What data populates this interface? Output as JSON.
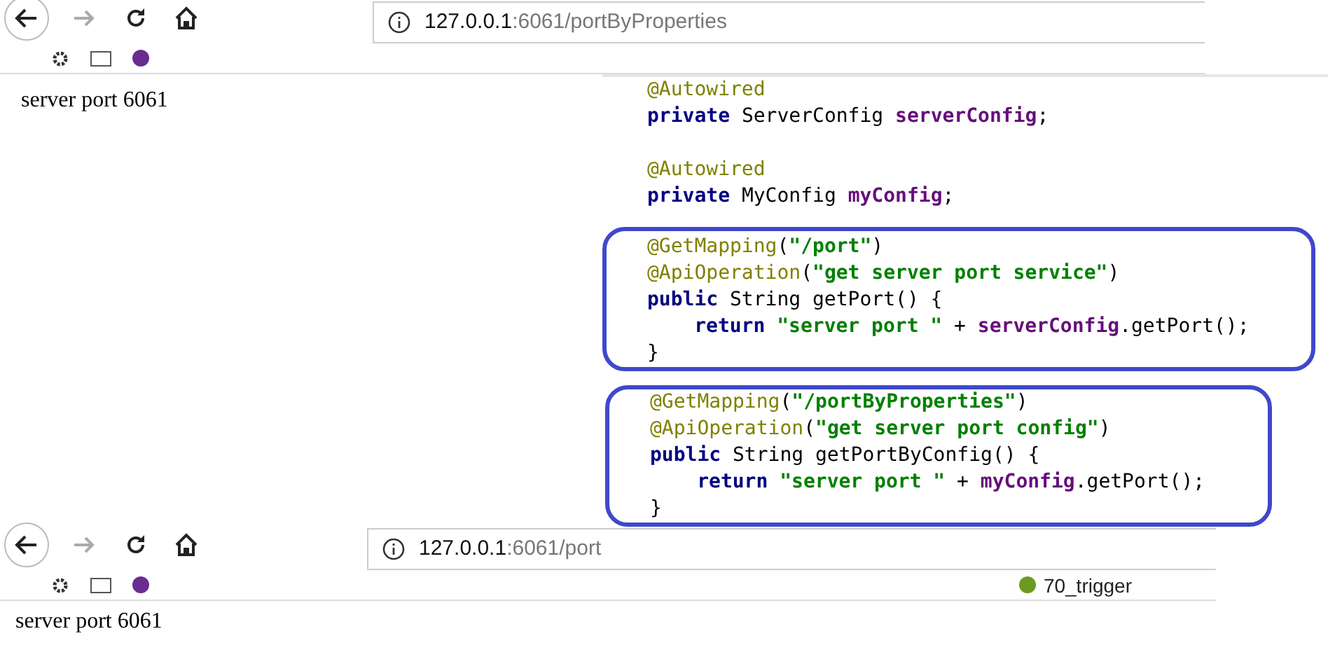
{
  "top_browser": {
    "url_host": "127.0.0.1",
    "url_path": ":6061/portByProperties",
    "page_text": "server port 6061"
  },
  "code": {
    "blocks": [
      {
        "highlighted": false,
        "lines": [
          {
            "indented": false,
            "tokens": [
              {
                "kind": "annotation",
                "text": "@Autowired"
              }
            ]
          },
          {
            "indented": false,
            "tokens": [
              {
                "kind": "keyword",
                "text": "private"
              },
              {
                "kind": "plain",
                "text": " ServerConfig "
              },
              {
                "kind": "field",
                "text": "serverConfig"
              },
              {
                "kind": "plain",
                "text": ";"
              }
            ]
          }
        ]
      },
      {
        "highlighted": false,
        "lines": [
          {
            "indented": false,
            "tokens": [
              {
                "kind": "annotation",
                "text": "@Autowired"
              }
            ]
          },
          {
            "indented": false,
            "tokens": [
              {
                "kind": "keyword",
                "text": "private"
              },
              {
                "kind": "plain",
                "text": " MyConfig "
              },
              {
                "kind": "field",
                "text": "myConfig"
              },
              {
                "kind": "plain",
                "text": ";"
              }
            ]
          }
        ]
      },
      {
        "highlighted": true,
        "lines": [
          {
            "indented": false,
            "tokens": [
              {
                "kind": "annotation",
                "text": "@GetMapping"
              },
              {
                "kind": "plain",
                "text": "("
              },
              {
                "kind": "string",
                "text": "\"/port\""
              },
              {
                "kind": "plain",
                "text": ")"
              }
            ]
          },
          {
            "indented": false,
            "tokens": [
              {
                "kind": "annotation",
                "text": "@ApiOperation"
              },
              {
                "kind": "plain",
                "text": "("
              },
              {
                "kind": "string",
                "text": "\"get server port service\""
              },
              {
                "kind": "plain",
                "text": ")"
              }
            ]
          },
          {
            "indented": false,
            "tokens": [
              {
                "kind": "keyword",
                "text": "public"
              },
              {
                "kind": "plain",
                "text": " String getPort() {"
              }
            ]
          },
          {
            "indented": true,
            "tokens": [
              {
                "kind": "keyword",
                "text": "return"
              },
              {
                "kind": "string",
                "text": " \"server port \""
              },
              {
                "kind": "plain",
                "text": " + "
              },
              {
                "kind": "field",
                "text": "serverConfig"
              },
              {
                "kind": "plain",
                "text": ".getPort();"
              }
            ]
          },
          {
            "indented": false,
            "tokens": [
              {
                "kind": "plain",
                "text": "}"
              }
            ]
          }
        ]
      },
      {
        "highlighted": true,
        "lines": [
          {
            "indented": false,
            "tokens": [
              {
                "kind": "annotation",
                "text": "@GetMapping"
              },
              {
                "kind": "plain",
                "text": "("
              },
              {
                "kind": "string",
                "text": "\"/portByProperties\""
              },
              {
                "kind": "plain",
                "text": ")"
              }
            ]
          },
          {
            "indented": false,
            "tokens": [
              {
                "kind": "annotation",
                "text": "@ApiOperation"
              },
              {
                "kind": "plain",
                "text": "("
              },
              {
                "kind": "string",
                "text": "\"get server port config\""
              },
              {
                "kind": "plain",
                "text": ")"
              }
            ]
          },
          {
            "indented": false,
            "tokens": [
              {
                "kind": "keyword",
                "text": "public"
              },
              {
                "kind": "plain",
                "text": " String getPortByConfig() {"
              }
            ]
          },
          {
            "indented": true,
            "tokens": [
              {
                "kind": "keyword",
                "text": "return"
              },
              {
                "kind": "string",
                "text": " \"server port \""
              },
              {
                "kind": "plain",
                "text": " + "
              },
              {
                "kind": "field",
                "text": "myConfig"
              },
              {
                "kind": "plain",
                "text": ".getPort();"
              }
            ]
          },
          {
            "indented": false,
            "tokens": [
              {
                "kind": "plain",
                "text": "}"
              }
            ]
          }
        ]
      }
    ]
  },
  "bottom_browser": {
    "url_host": "127.0.0.1",
    "url_path": ":6061/port",
    "bookmarks": [
      {
        "label": "70_trigger"
      }
    ],
    "page_text": "server port 6061"
  }
}
